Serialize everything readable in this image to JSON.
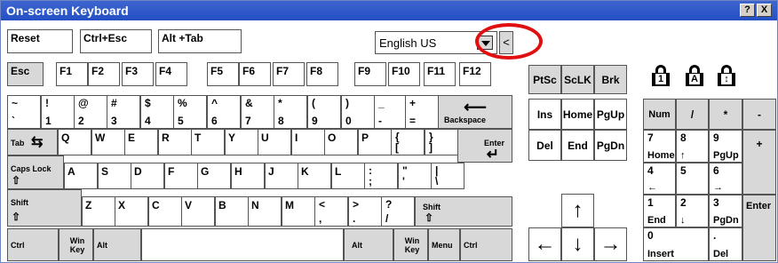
{
  "window": {
    "title": "On-screen Keyboard",
    "help_label": "?",
    "close_label": "X"
  },
  "toolbar": {
    "reset_label": "Reset",
    "ctrl_esc_label": "Ctrl+Esc",
    "alt_tab_label": "Alt +Tab",
    "language": "English US",
    "collapse_label": "<"
  },
  "indicators": {
    "num_lock": "1",
    "caps_lock": "A",
    "scroll_lock": "↕"
  },
  "keys": {
    "esc": "Esc",
    "f1": "F1",
    "f2": "F2",
    "f3": "F3",
    "f4": "F4",
    "f5": "F5",
    "f6": "F6",
    "f7": "F7",
    "f8": "F8",
    "f9": "F9",
    "f10": "F10",
    "f11": "F11",
    "f12": "F12",
    "ptsc": "PtSc",
    "sclk": "ScLK",
    "brk": "Brk",
    "ins": "Ins",
    "home": "Home",
    "pgup": "PgUp",
    "del": "Del",
    "end": "End",
    "pgdn": "PgDn",
    "backspace": "Backspace",
    "backspace_arrow": "⟵",
    "tab": "Tab",
    "enter": "Enter",
    "enter_arrow": "↵",
    "caps": "Caps Lock",
    "caps_arrow": "⇧",
    "shift": "Shift",
    "shift_arrow": "⇧",
    "ctrl": "Ctrl",
    "alt": "Alt",
    "win": "Win Key",
    "menu": "Menu",
    "num": "Num",
    "np_div": "/",
    "np_mul": "*",
    "np_minus": "-",
    "np_plus": "+",
    "np_enter": "Enter",
    "np7": "7",
    "np7_sub": "Home",
    "np8": "8",
    "np8_sub": "↑",
    "np9": "9",
    "np9_sub": "PgUp",
    "np4": "4",
    "np4_sub": "←",
    "np5": "5",
    "np6": "6",
    "np6_sub": "→",
    "np1": "1",
    "np1_sub": "End",
    "np2": "2",
    "np2_sub": "↓",
    "np3": "3",
    "np3_sub": "PgDn",
    "np0": "0",
    "np0_sub": "Insert",
    "npdot": ".",
    "npdot_sub": "Del",
    "arrow_up": "↑",
    "arrow_down": "↓",
    "arrow_left": "←",
    "arrow_right": "→",
    "row1": [
      [
        "~",
        "`"
      ],
      [
        "!",
        "1"
      ],
      [
        "@",
        "2"
      ],
      [
        "#",
        "3"
      ],
      [
        "$",
        "4"
      ],
      [
        "%",
        "5"
      ],
      [
        "^",
        "6"
      ],
      [
        "&",
        "7"
      ],
      [
        "*",
        "8"
      ],
      [
        "(",
        "9"
      ],
      [
        ")",
        "0"
      ],
      [
        "_",
        "-"
      ],
      [
        "+",
        "="
      ]
    ],
    "row2": [
      "Q",
      "W",
      "E",
      "R",
      "T",
      "Y",
      "U",
      "I",
      "O",
      "P",
      [
        "{",
        "["
      ],
      [
        "}",
        "]"
      ]
    ],
    "row3": [
      "A",
      "S",
      "D",
      "F",
      "G",
      "H",
      "J",
      "K",
      "L",
      [
        ":",
        ";"
      ],
      [
        "\"",
        "'"
      ],
      [
        "|",
        "\\"
      ]
    ],
    "row4": [
      "Z",
      "X",
      "C",
      "V",
      "B",
      "N",
      "M",
      [
        "<",
        ","
      ],
      [
        ">",
        "."
      ],
      [
        "?",
        "/"
      ]
    ]
  }
}
